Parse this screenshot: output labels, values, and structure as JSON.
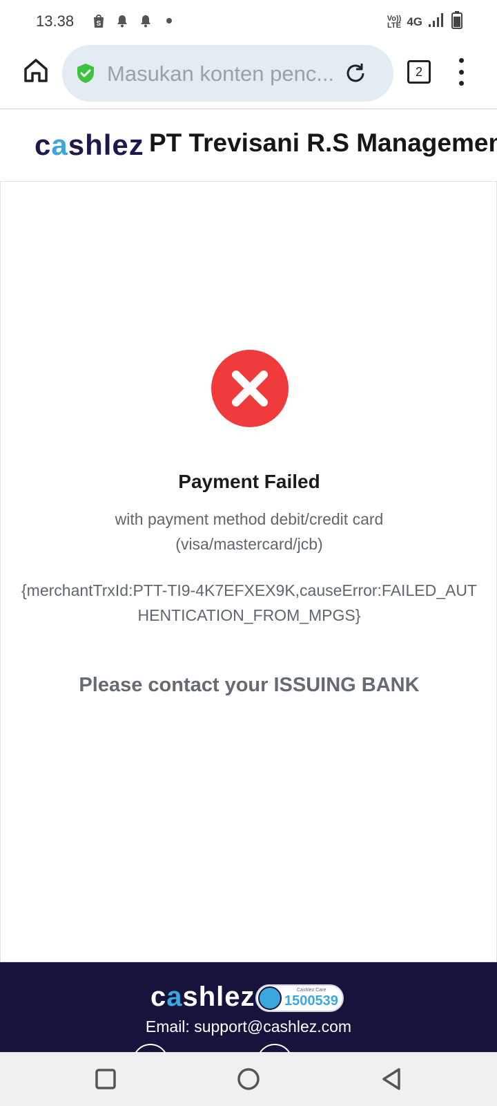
{
  "status_bar": {
    "time": "13.38",
    "volte_top": "Vo))",
    "volte_bottom": "LTE",
    "network": "4G"
  },
  "browser": {
    "url_placeholder": "Masukan konten penc...",
    "tab_count": "2"
  },
  "merchant": {
    "logo_prefix": "c",
    "logo_accent": "a",
    "logo_suffix": "shlez",
    "name": "PT Trevisani R.S Management"
  },
  "payment": {
    "title": "Payment Failed",
    "description": "with payment method debit/credit card (visa/mastercard/jcb)",
    "error_detail": "{merchantTrxId:PTT-TI9-4K7EFXEX9K,causeError:FAILED_AUTHENTICATION_FROM_MPGS}",
    "contact_message": "Please contact your ISSUING BANK"
  },
  "footer": {
    "logo_prefix": "c",
    "logo_accent": "a",
    "logo_suffix": "shlez",
    "care_caption": "Cashlez Care",
    "care_number": "1500539",
    "email_text": "Email: support@cashlez.com"
  },
  "colors": {
    "error_red": "#ef3b3b",
    "brand_navy": "#16143d",
    "brand_blue": "#3ba7df",
    "secure_green": "#3cc43c"
  }
}
